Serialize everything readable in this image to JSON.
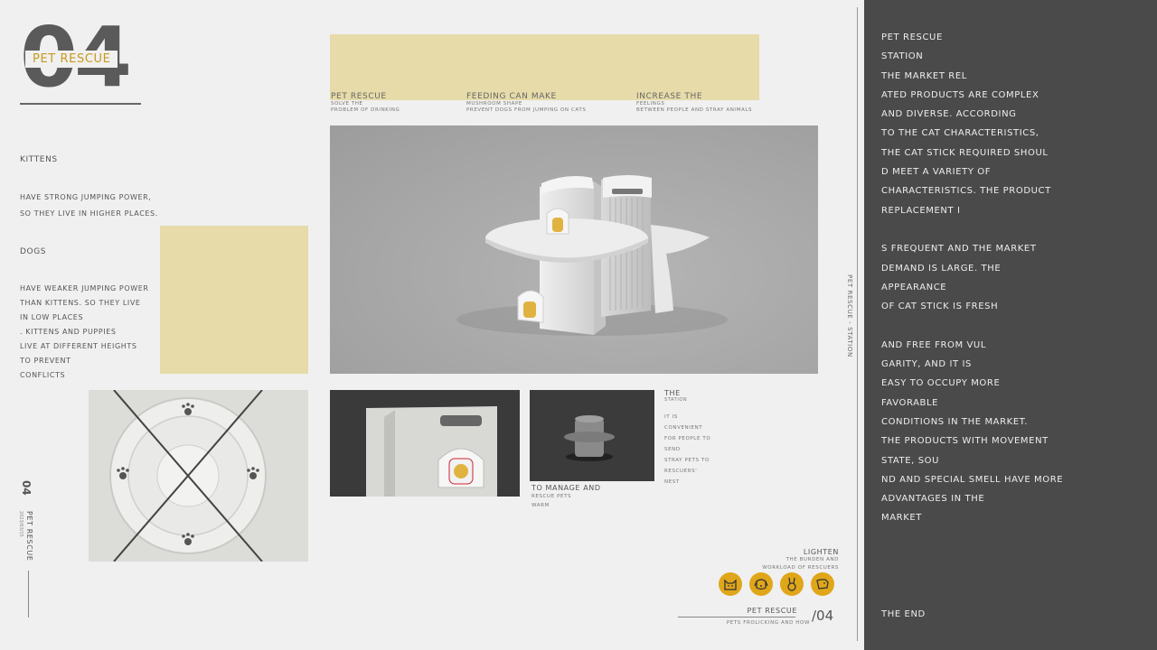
{
  "header": {
    "big_number": "04",
    "logo_label": "Pet Rescue"
  },
  "top_captions": [
    {
      "title": "Pet Rescue",
      "line1": "Solve the",
      "line2": "problem of drinking"
    },
    {
      "title": "Feeding can make",
      "line1": "mushroom shape",
      "line2": "prevent dogs from jumping on cats"
    },
    {
      "title": "Increase the",
      "line1": "feelings",
      "line2": "between people and stray animals"
    }
  ],
  "left_text": {
    "kittens_heading": "Kittens",
    "kittens_line1": "Have strong jumping power,",
    "kittens_line2": "so they live in higher places.",
    "dogs_heading": "Dogs",
    "dogs_lines": [
      "Have weaker jumping power",
      "than kittens. so they live",
      " in low places",
      ". Kittens and puppies",
      "live at different heights",
      "to prevent",
      "conflicts"
    ]
  },
  "vertical_label": {
    "number": "04",
    "title": "Pet Rescue",
    "sub": "2023/03/15"
  },
  "station_caption": {
    "title": "The",
    "sub": "station",
    "lines": [
      "It is",
      "convenient",
      "for people to",
      "send",
      "stray pets to",
      "rescuers'",
      "nest"
    ]
  },
  "manage_caption": {
    "title": "To manage and",
    "line1": "rescue pets",
    "line2": "warm"
  },
  "lighten_caption": {
    "title": "Lighten",
    "line1": "the burden and",
    "line2": "workload of rescuers"
  },
  "footer": {
    "label": "Pet Rescue",
    "sub": "Pets frolicking and how",
    "page": "/04"
  },
  "vertical_station_label": "Pet Rescue - Station",
  "right_panel": {
    "lines": [
      "Pet Rescue",
      "Station",
      "",
      "",
      "The market rel",
      "ated products are complex",
      "and diverse. According",
      "to the cat characteristics,",
      "the cat stick required shoul",
      "d meet a variety of",
      "characteristics. The product",
      "replacement i",
      "",
      "s frequent and the market",
      "demand is large. The",
      "appearance",
      "of cat stick is fresh",
      "",
      "and free from vul",
      "garity, and it is",
      "easy to occupy more",
      " favorable",
      "conditions in the market.",
      "The products with movement",
      "state, sou",
      "nd and special smell have more",
      "advantages in the",
      "market"
    ],
    "end_label": "The End"
  },
  "colors": {
    "accent": "#e0a61a",
    "yellow_block": "#e6dba9",
    "panel": "#4a4a4a",
    "background": "#f0f0f0"
  },
  "icons": [
    "cat-face-icon",
    "dog-face-icon",
    "rabbit-icon",
    "puppy-icon"
  ]
}
